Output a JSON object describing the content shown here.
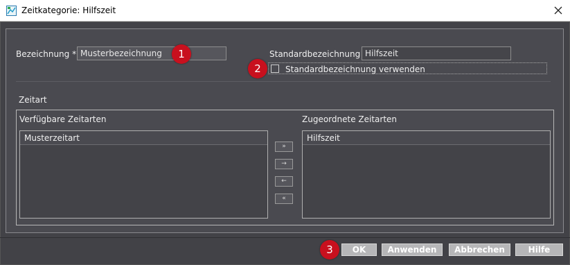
{
  "window": {
    "title": "Zeitkategorie: Hilfszeit"
  },
  "form": {
    "bezeichnung_label": "Bezeichnung *",
    "bezeichnung_value": "Musterbezeichnung",
    "standard_label": "Standardbezeichnung",
    "standard_value": "Hilfszeit",
    "checkbox_label": "Standardbezeichnung verwenden",
    "checkbox_checked": false
  },
  "zeitart": {
    "section_label": "Zeitart",
    "available_label": "Verfügbare Zeitarten",
    "available_header": "Musterzeitart",
    "assigned_label": "Zugeordnete Zeitarten",
    "assigned_header": "Hilfszeit",
    "move_buttons": [
      "»",
      "→",
      "←",
      "«"
    ]
  },
  "badges": [
    "1",
    "2",
    "3"
  ],
  "footer": {
    "ok": "OK",
    "apply": "Anwenden",
    "cancel": "Abbrechen",
    "help": "Hilfe"
  },
  "colors": {
    "badge": "#c8101e",
    "button": "#b6b6b8",
    "background": "#424247"
  }
}
